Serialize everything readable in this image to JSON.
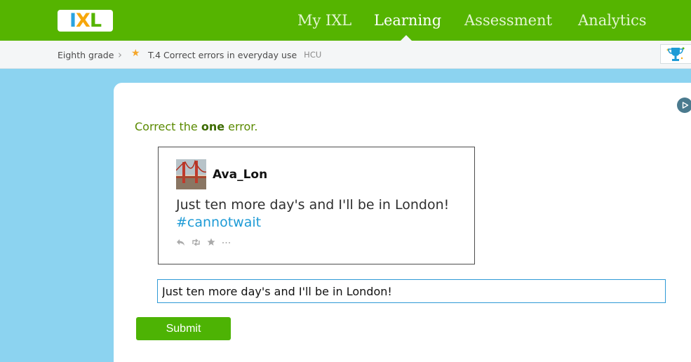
{
  "header": {
    "logo_text": "IXL",
    "logo_colors": {
      "I": "#2aa3e0",
      "X": "#f7a70b",
      "L": "#55b400"
    },
    "bar_color": "#55b400",
    "nav": [
      {
        "label": "My IXL",
        "active": false
      },
      {
        "label": "Learning",
        "active": true
      },
      {
        "label": "Assessment",
        "active": false
      },
      {
        "label": "Analytics",
        "active": false
      }
    ]
  },
  "breadcrumb": {
    "grade": "Eighth grade",
    "separator_icon": "chevron-right-icon",
    "star_icon": "star-icon",
    "skill": "T.4 Correct errors in everyday use",
    "code": "HCU",
    "award_icon": "trophy-icon"
  },
  "question": {
    "instruction_prefix": "Correct the ",
    "instruction_emphasis": "one",
    "instruction_suffix": " error.",
    "tweet": {
      "username": "Ava_Lon",
      "text": "Just ten more day's and I'll be in London! ",
      "hashtag": "#cannotwait",
      "action_icons": [
        "reply-icon",
        "retweet-icon",
        "favorite-icon",
        "more-icon"
      ]
    },
    "answer_value": "Just ten more day's and I'll be in London!",
    "submit_label": "Submit",
    "play_icon": "play-icon"
  },
  "colors": {
    "background": "#8cd3f0",
    "instruction_text": "#5a8a00",
    "hashtag": "#1e9bd6",
    "submit": "#4db304",
    "input_border": "#2f9ad6"
  }
}
